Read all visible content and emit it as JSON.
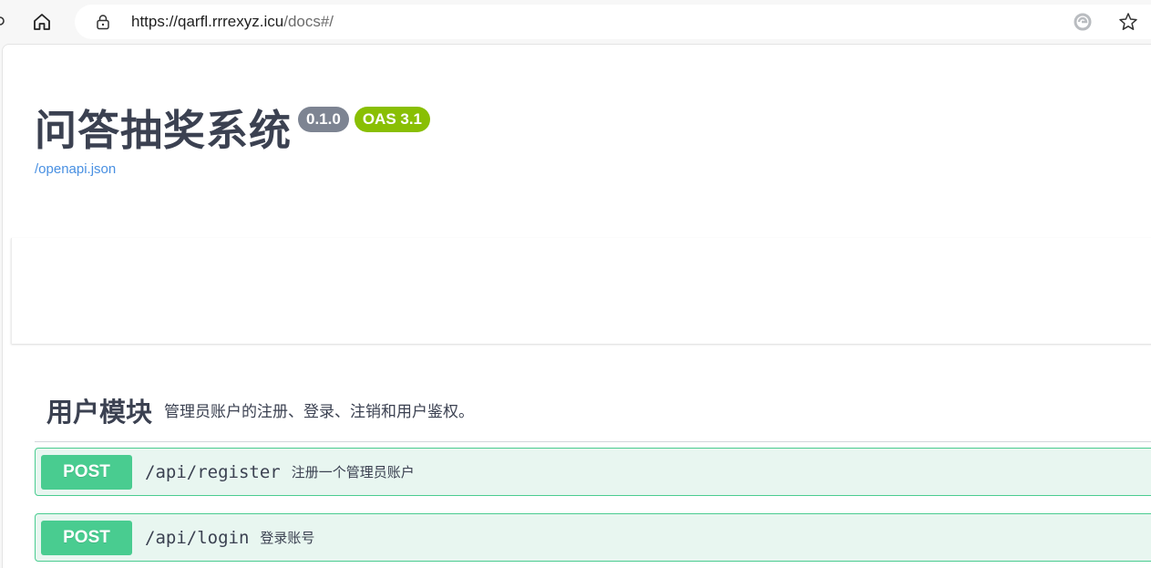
{
  "browser": {
    "url_host": "https://qarfl.rrrexyz.icu",
    "url_path": "/docs#/",
    "home_icon": "home-icon",
    "lock_icon": "lock-icon",
    "extension_icon": "edge-extension-icon",
    "favorite_icon": "star-icon"
  },
  "info": {
    "title": "问答抽奖系统",
    "version": "0.1.0",
    "oas_version": "OAS 3.1",
    "spec_link": "/openapi.json"
  },
  "tags": [
    {
      "name": "用户模块",
      "description": "管理员账户的注册、登录、注销和用户鉴权。",
      "operations": [
        {
          "method": "POST",
          "path": "/api/register",
          "summary": "注册一个管理员账户"
        },
        {
          "method": "POST",
          "path": "/api/login",
          "summary": "登录账号"
        }
      ]
    }
  ],
  "colors": {
    "post": "#49cc90",
    "post_bg": "#e8f6f0",
    "version_badge": "#7d8492",
    "oas_badge": "#89bf04",
    "link": "#4990e2",
    "text": "#3b4151"
  }
}
